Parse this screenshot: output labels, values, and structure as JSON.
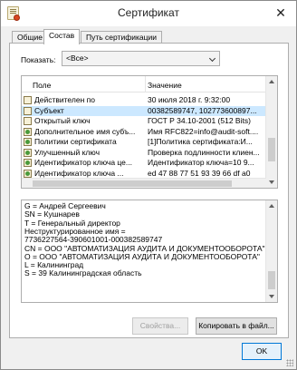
{
  "window": {
    "title": "Сертификат",
    "close_glyph": "✕"
  },
  "tabs": [
    {
      "label": "Общие",
      "active": false
    },
    {
      "label": "Состав",
      "active": true
    },
    {
      "label": "Путь сертификации",
      "active": false
    }
  ],
  "filter": {
    "label": "Показать:",
    "selected": "<Все>"
  },
  "fields": {
    "columns": [
      "Поле",
      "Значение"
    ],
    "rows": [
      {
        "icon": "certificate-field-icon",
        "name": "Действителен по",
        "value": "30 июля 2018 г. 9:32:00",
        "selected": false
      },
      {
        "icon": "certificate-field-icon",
        "name": "Субъект",
        "value": "00382589747, 102773600897...",
        "selected": true
      },
      {
        "icon": "certificate-field-icon",
        "name": "Открытый ключ",
        "value": "ГОСТ Р 34.10-2001 (512 Bits)",
        "selected": false
      },
      {
        "icon": "extension-field-icon",
        "name": "Дополнительное имя субъ...",
        "value": "Имя RFC822=info@audit-soft....",
        "selected": false
      },
      {
        "icon": "extension-field-icon",
        "name": "Политики сертификата",
        "value": "[1]Политика сертификата:И...",
        "selected": false
      },
      {
        "icon": "extension-field-icon",
        "name": "Улучшенный ключ",
        "value": "Проверка подлинности клиен...",
        "selected": false
      },
      {
        "icon": "extension-field-icon",
        "name": "Идентификатор ключа це...",
        "value": "Идентификатор ключа=10 9...",
        "selected": false
      },
      {
        "icon": "extension-field-icon",
        "name": "Идентификатор ключа ...",
        "value": "ed 47 88 77 51 93 39 66 df a0",
        "selected": false
      }
    ]
  },
  "detail_lines": [
    "G = Андрей Сергеевич",
    "SN = Кушнарев",
    "T = Генеральный директор",
    "Неструктурированное имя =",
    "7736227564-390601001-000382589747",
    "CN = ООО \"АВТОМАТИЗАЦИЯ АУДИТА И ДОКУМЕНТООБОРОТА\"",
    "O = ООО \"АВТОМАТИЗАЦИЯ АУДИТА И ДОКУМЕНТООБОРОТА\"",
    "L = Калининград",
    "S = 39 Калининградская область"
  ],
  "buttons": {
    "properties": "Свойства...",
    "copy_to_file": "Копировать в файл...",
    "ok": "OK"
  }
}
